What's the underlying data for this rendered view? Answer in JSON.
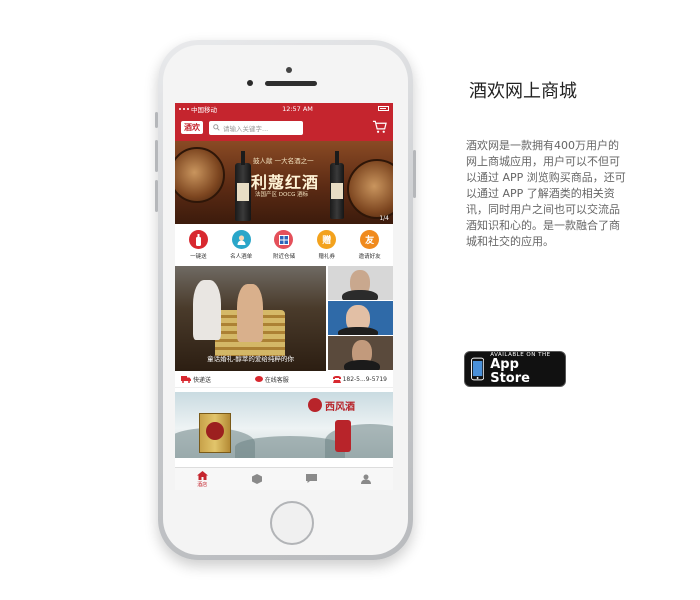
{
  "status_bar": {
    "carrier": "中国移动",
    "time": "12:57 AM"
  },
  "header": {
    "logo": "酒欢",
    "search_placeholder": "请输入关键字..."
  },
  "banner": {
    "small_text": "鼓人献 一大名酒之一",
    "title": "利蔻红酒",
    "sub_text": "法国产区 DOCG 酒标",
    "page_indicator": "1/4"
  },
  "categories": [
    {
      "label": "一键送",
      "color": "#d8282f",
      "icon": "bottle-icon",
      "glyph": ""
    },
    {
      "label": "名人酒单",
      "color": "#2aa6c9",
      "icon": "celebrity-icon",
      "glyph": ""
    },
    {
      "label": "附近仓储",
      "color": "#e4505a",
      "icon": "warehouse-icon",
      "glyph": ""
    },
    {
      "label": "赠礼券",
      "color": "#f3a21d",
      "icon": "gift-icon",
      "glyph": "赠"
    },
    {
      "label": "邀请好友",
      "color": "#f08a1d",
      "icon": "friend-icon",
      "glyph": "友"
    }
  ],
  "feature": {
    "caption": "童话婚礼-醇萃的爱给纯粹的你"
  },
  "services": [
    {
      "label": "快递送",
      "icon": "truck-icon"
    },
    {
      "label": "在线客服",
      "icon": "chat-icon"
    },
    {
      "label": "182-5...9-5719",
      "icon": "phone-icon"
    }
  ],
  "promo": {
    "brand_text": "西风酒"
  },
  "tabs": [
    {
      "label": "酒店",
      "icon": "home-icon",
      "active": true
    },
    {
      "label": "",
      "icon": "box-icon",
      "active": false
    },
    {
      "label": "",
      "icon": "message-icon",
      "active": false
    },
    {
      "label": "",
      "icon": "person-icon",
      "active": false
    }
  ],
  "info": {
    "title": "酒欢网上商城",
    "description": "酒欢网是一款拥有400万用户的网上商城应用，用户可以不但可以通过 APP 浏览购买商品，还可以通过 APP 了解酒类的相关资讯，同时用户之间也可以交流品酒知识和心的。是一款融合了商城和社交的应用。"
  },
  "appstore": {
    "small": "AVAILABLE ON THE",
    "big": "App Store"
  },
  "colors": {
    "brand_red": "#c5252e"
  }
}
